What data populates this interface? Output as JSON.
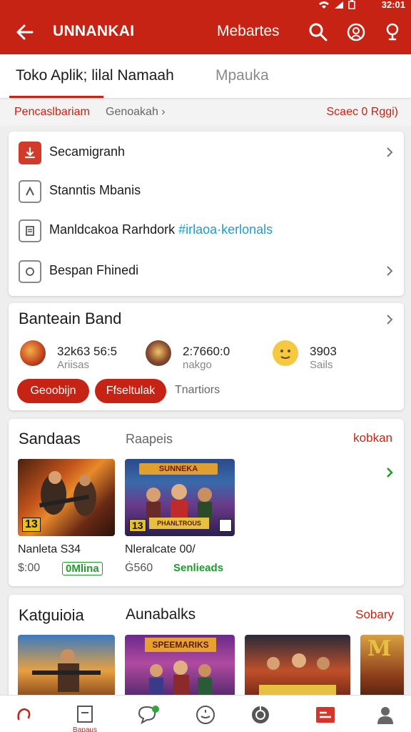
{
  "status_bar": {
    "time": "32:01"
  },
  "app_bar": {
    "title": "UNNANKAI",
    "action_label": "Mebartes"
  },
  "tabs": [
    {
      "label": "Toko Aplik; lilal Namaah"
    },
    {
      "label": "Mpauka"
    }
  ],
  "crumb": {
    "primary": "Pencaslbariam",
    "secondary": "Genoakah ›",
    "right": "Scaec 0 Rggi)"
  },
  "menu": {
    "items": [
      {
        "label": "Secamigranh",
        "icon": "download-icon"
      },
      {
        "label": "Stanntis Mbanis",
        "icon": "arrow-up-icon"
      },
      {
        "label": "Manldcakoa Rarhdork",
        "link": "#irlaoa·kerlonals",
        "icon": "document-icon"
      },
      {
        "label": "Bespan Fhinedi",
        "icon": "circle-icon"
      }
    ]
  },
  "band": {
    "title": "Banteain Band",
    "users": [
      {
        "line1": "32k63 56:5",
        "line2": "Ariisas"
      },
      {
        "line1": "2:7660:0",
        "line2": "nakgo"
      },
      {
        "line1": "3903",
        "line2": "Sails"
      }
    ],
    "pills": [
      "Geoobijn",
      "Ffseltulak"
    ],
    "plain": "Tnartiors"
  },
  "games": {
    "title": "Sandaas",
    "subtitle": "Raapeis",
    "more": "kobkan",
    "items": [
      {
        "name": "Nanleta S34",
        "price": "$:00",
        "tag": "0Mlina",
        "badge": "13"
      },
      {
        "name": "Nleralcate 00/",
        "price": "Ġ560",
        "tag": "Senlieads",
        "badge": "13",
        "banner": "SUNNEKA",
        "caption": "PHANLTROUS"
      }
    ]
  },
  "categories": {
    "title": "Katguioia",
    "subtitle": "Aunabalks",
    "more": "Sobary",
    "tiles": [
      {
        "banner": ""
      },
      {
        "banner": "SPEEMARIKS"
      },
      {
        "banner": ""
      },
      {
        "banner": "M"
      }
    ]
  },
  "bottom_nav": {
    "items": [
      {
        "icon": "home-icon",
        "label": ""
      },
      {
        "icon": "store-icon",
        "label": "Bapaus"
      },
      {
        "icon": "chat-icon",
        "label": ""
      },
      {
        "icon": "clock-icon",
        "label": ""
      },
      {
        "icon": "games-icon",
        "label": ""
      },
      {
        "icon": "list-icon",
        "label": ""
      },
      {
        "icon": "profile-icon",
        "label": ""
      }
    ]
  },
  "colors": {
    "primary": "#c62314",
    "green": "#1f9a2c",
    "link": "#1e9bcf"
  }
}
